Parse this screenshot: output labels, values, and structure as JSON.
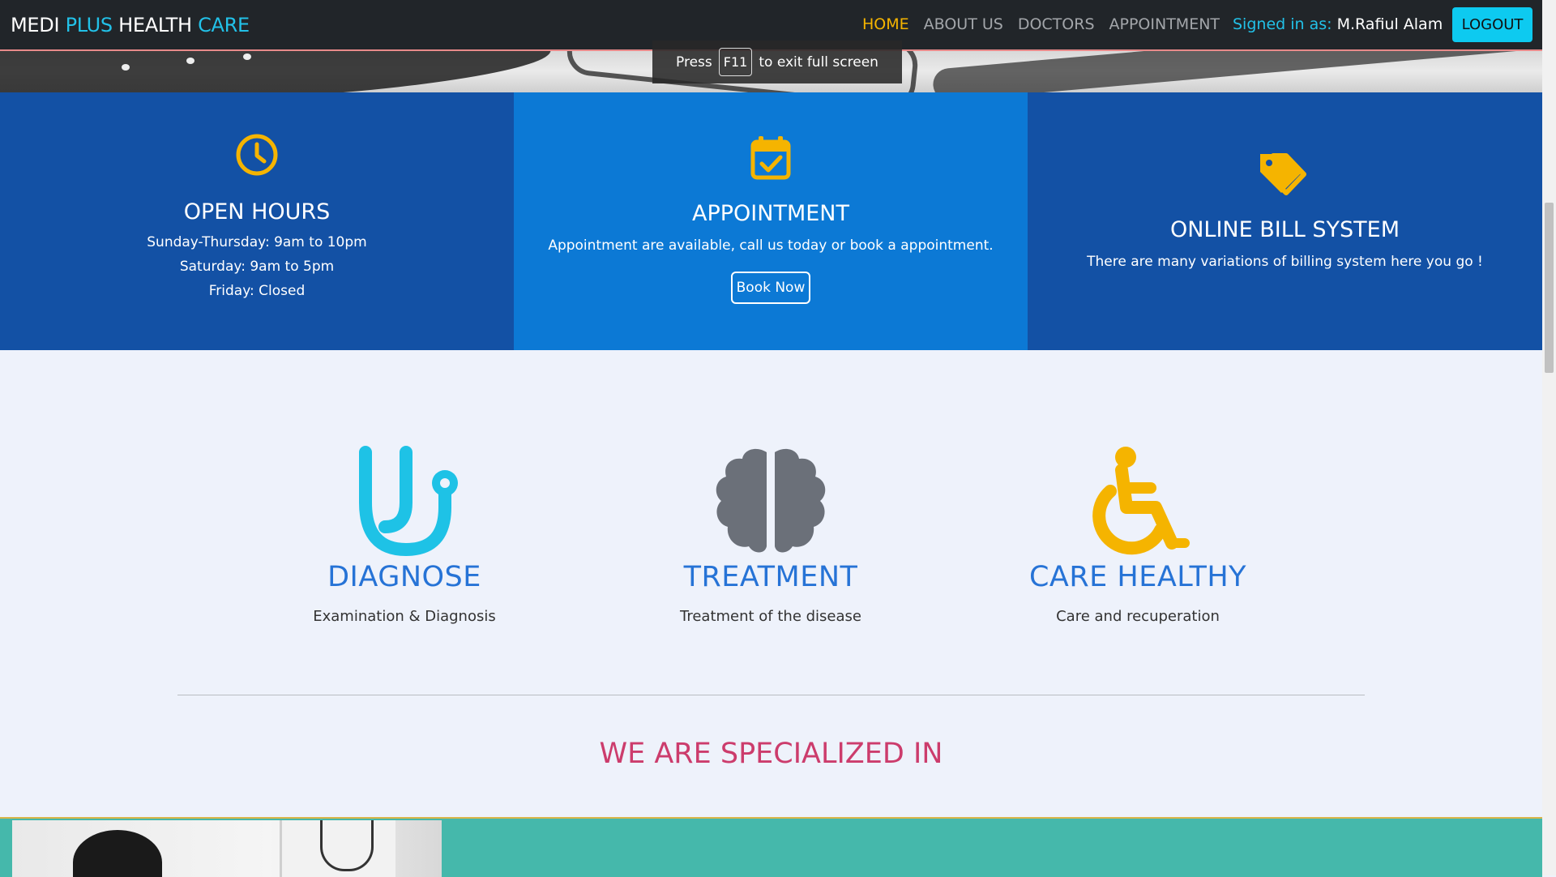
{
  "navbar": {
    "brand": {
      "part1": "MEDI ",
      "part2": "PLUS",
      "part3": " HEALTH ",
      "part4": "CARE"
    },
    "links": [
      "HOME",
      "ABOUT US",
      "DOCTORS",
      "APPOINTMENT"
    ],
    "active_link": "HOME",
    "signed_in_label": "Signed in as:",
    "user_name": "M.Rafiul Alam",
    "logout_label": "LOGOUT"
  },
  "fullscreen_notice": {
    "before": "Press",
    "key": "F11",
    "after": "to exit full screen"
  },
  "info": {
    "open_hours": {
      "icon": "clock-icon",
      "title": "OPEN HOURS",
      "lines": [
        "Sunday-Thursday: 9am to 10pm",
        "Saturday: 9am to 5pm",
        "Friday: Closed"
      ]
    },
    "appointment": {
      "icon": "calendar-check-icon",
      "title": "APPOINTMENT",
      "text": "Appointment are available, call us today or book a appointment.",
      "button": "Book Now"
    },
    "billing": {
      "icon": "tags-icon",
      "title": "ONLINE BILL SYSTEM",
      "text": "There are many variations of billing system here you go !"
    }
  },
  "services": [
    {
      "icon": "stethoscope-icon",
      "title": "DIAGNOSE",
      "desc": "Examination & Diagnosis"
    },
    {
      "icon": "brain-icon",
      "title": "TREATMENT",
      "desc": "Treatment of the disease"
    },
    {
      "icon": "wheelchair-icon",
      "title": "CARE HEALTHY",
      "desc": "Care and recuperation"
    }
  ],
  "specialized_heading": "WE ARE SPECIALIZED IN",
  "colors": {
    "navbar_bg": "#212529",
    "accent_cyan": "#0dcaf0",
    "active_nav": "#f5b400",
    "info_dark": "#1351a5",
    "info_mid": "#0c79d5",
    "icon_yellow": "#f5b400",
    "service_title": "#2673d6",
    "specialized_heading": "#cc3c6c",
    "band_teal": "#45b8ab"
  }
}
